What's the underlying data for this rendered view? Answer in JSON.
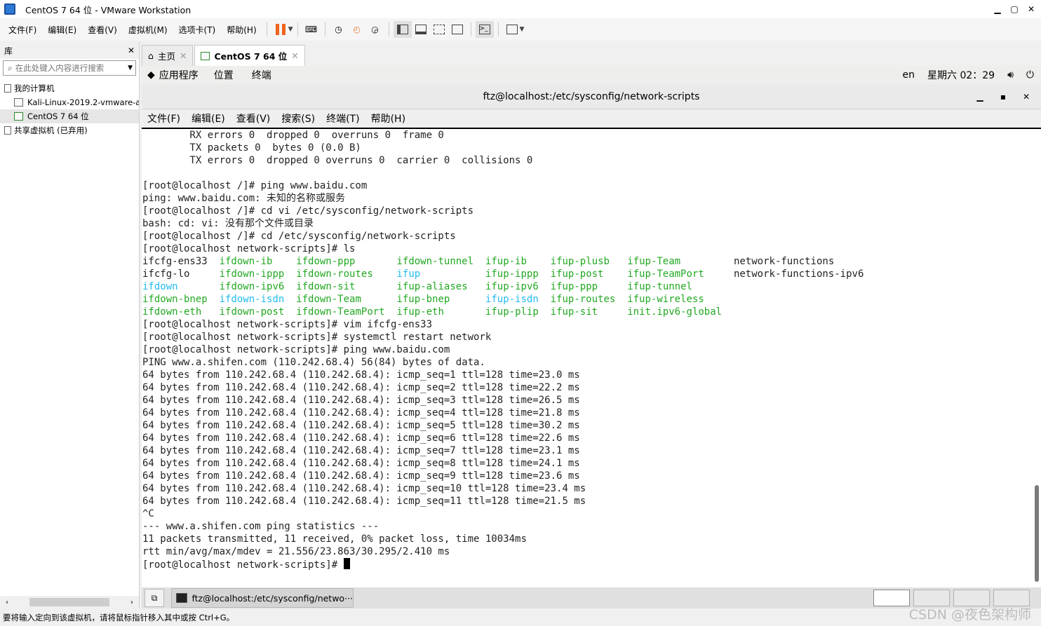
{
  "window": {
    "title": "CentOS 7 64 位 - VMware Workstation"
  },
  "menubar": {
    "items": [
      "文件(F)",
      "编辑(E)",
      "查看(V)",
      "虚拟机(M)",
      "选项卡(T)",
      "帮助(H)"
    ]
  },
  "sidebar": {
    "title": "库",
    "close": "✕",
    "search_placeholder": "在此处键入内容进行搜索",
    "tree": {
      "my_computer": "我的计算机",
      "vm1": "Kali-Linux-2019.2-vmware-a",
      "vm2": "CentOS 7 64 位",
      "shared": "共享虚拟机 (已弃用)"
    }
  },
  "tabs": [
    {
      "label": "主页"
    },
    {
      "label": "CentOS 7 64 位"
    }
  ],
  "gnome": {
    "apps": "应用程序",
    "places": "位置",
    "terminal": "终端",
    "lang": "en",
    "clock": "星期六 02：29"
  },
  "terminal": {
    "title": "ftz@localhost:/etc/sysconfig/network-scripts",
    "menu": [
      "文件(F)",
      "编辑(E)",
      "查看(V)",
      "搜索(S)",
      "终端(T)",
      "帮助(H)"
    ],
    "lines": [
      "        RX errors 0  dropped 0  overruns 0  frame 0",
      "        TX packets 0  bytes 0 (0.0 B)",
      "        TX errors 0  dropped 0 overruns 0  carrier 0  collisions 0",
      "",
      "[root@localhost /]# ping www.baidu.com",
      "ping: www.baidu.com: 未知的名称或服务",
      "[root@localhost /]# cd vi /etc/sysconfig/network-scripts",
      "bash: cd: vi: 没有那个文件或目录",
      "[root@localhost /]# cd /etc/sysconfig/network-scripts",
      "[root@localhost network-scripts]# ls"
    ],
    "ls_rows": [
      [
        [
          "ifcfg-ens33",
          ""
        ],
        [
          "ifdown-ib",
          "g"
        ],
        [
          "ifdown-ppp",
          "g"
        ],
        [
          "ifdown-tunnel",
          "g"
        ],
        [
          "ifup-ib",
          "g"
        ],
        [
          "ifup-plusb",
          "g"
        ],
        [
          "ifup-Team",
          "g"
        ],
        [
          "network-functions",
          ""
        ]
      ],
      [
        [
          "ifcfg-lo",
          ""
        ],
        [
          "ifdown-ippp",
          "g"
        ],
        [
          "ifdown-routes",
          "g"
        ],
        [
          "ifup",
          "c"
        ],
        [
          "ifup-ippp",
          "g"
        ],
        [
          "ifup-post",
          "g"
        ],
        [
          "ifup-TeamPort",
          "g"
        ],
        [
          "network-functions-ipv6",
          ""
        ]
      ],
      [
        [
          "ifdown",
          "c"
        ],
        [
          "ifdown-ipv6",
          "g"
        ],
        [
          "ifdown-sit",
          "g"
        ],
        [
          "ifup-aliases",
          "g"
        ],
        [
          "ifup-ipv6",
          "g"
        ],
        [
          "ifup-ppp",
          "g"
        ],
        [
          "ifup-tunnel",
          "g"
        ],
        [
          "",
          ""
        ]
      ],
      [
        [
          "ifdown-bnep",
          "g"
        ],
        [
          "ifdown-isdn",
          "c"
        ],
        [
          "ifdown-Team",
          "g"
        ],
        [
          "ifup-bnep",
          "g"
        ],
        [
          "ifup-isdn",
          "c"
        ],
        [
          "ifup-routes",
          "g"
        ],
        [
          "ifup-wireless",
          "g"
        ],
        [
          "",
          ""
        ]
      ],
      [
        [
          "ifdown-eth",
          "g"
        ],
        [
          "ifdown-post",
          "g"
        ],
        [
          "ifdown-TeamPort",
          "g"
        ],
        [
          "ifup-eth",
          "g"
        ],
        [
          "ifup-plip",
          "g"
        ],
        [
          "ifup-sit",
          "g"
        ],
        [
          "init.ipv6-global",
          "g"
        ],
        [
          "",
          ""
        ]
      ]
    ],
    "lines_after": [
      "[root@localhost network-scripts]# vim ifcfg-ens33",
      "[root@localhost network-scripts]# systemctl restart network",
      "[root@localhost network-scripts]# ping www.baidu.com",
      "PING www.a.shifen.com (110.242.68.4) 56(84) bytes of data.",
      "64 bytes from 110.242.68.4 (110.242.68.4): icmp_seq=1 ttl=128 time=23.0 ms",
      "64 bytes from 110.242.68.4 (110.242.68.4): icmp_seq=2 ttl=128 time=22.2 ms",
      "64 bytes from 110.242.68.4 (110.242.68.4): icmp_seq=3 ttl=128 time=26.5 ms",
      "64 bytes from 110.242.68.4 (110.242.68.4): icmp_seq=4 ttl=128 time=21.8 ms",
      "64 bytes from 110.242.68.4 (110.242.68.4): icmp_seq=5 ttl=128 time=30.2 ms",
      "64 bytes from 110.242.68.4 (110.242.68.4): icmp_seq=6 ttl=128 time=22.6 ms",
      "64 bytes from 110.242.68.4 (110.242.68.4): icmp_seq=7 ttl=128 time=23.1 ms",
      "64 bytes from 110.242.68.4 (110.242.68.4): icmp_seq=8 ttl=128 time=24.1 ms",
      "64 bytes from 110.242.68.4 (110.242.68.4): icmp_seq=9 ttl=128 time=23.6 ms",
      "64 bytes from 110.242.68.4 (110.242.68.4): icmp_seq=10 ttl=128 time=23.4 ms",
      "64 bytes from 110.242.68.4 (110.242.68.4): icmp_seq=11 ttl=128 time=21.5 ms",
      "^C",
      "--- www.a.shifen.com ping statistics ---",
      "11 packets transmitted, 11 received, 0% packet loss, time 10034ms",
      "rtt min/avg/max/mdev = 21.556/23.863/30.295/2.410 ms"
    ],
    "prompt": "[root@localhost network-scripts]# "
  },
  "taskbar": {
    "item": "ftz@localhost:/etc/sysconfig/netwo···"
  },
  "statusbar": {
    "text": "要将输入定向到该虚拟机，请将鼠标指针移入其中或按 Ctrl+G。"
  },
  "watermark": "CSDN @夜色架构师",
  "colors": {
    "ls_exec": "#22a822",
    "ls_link": "#22bbee",
    "pause": "#f0641e"
  }
}
